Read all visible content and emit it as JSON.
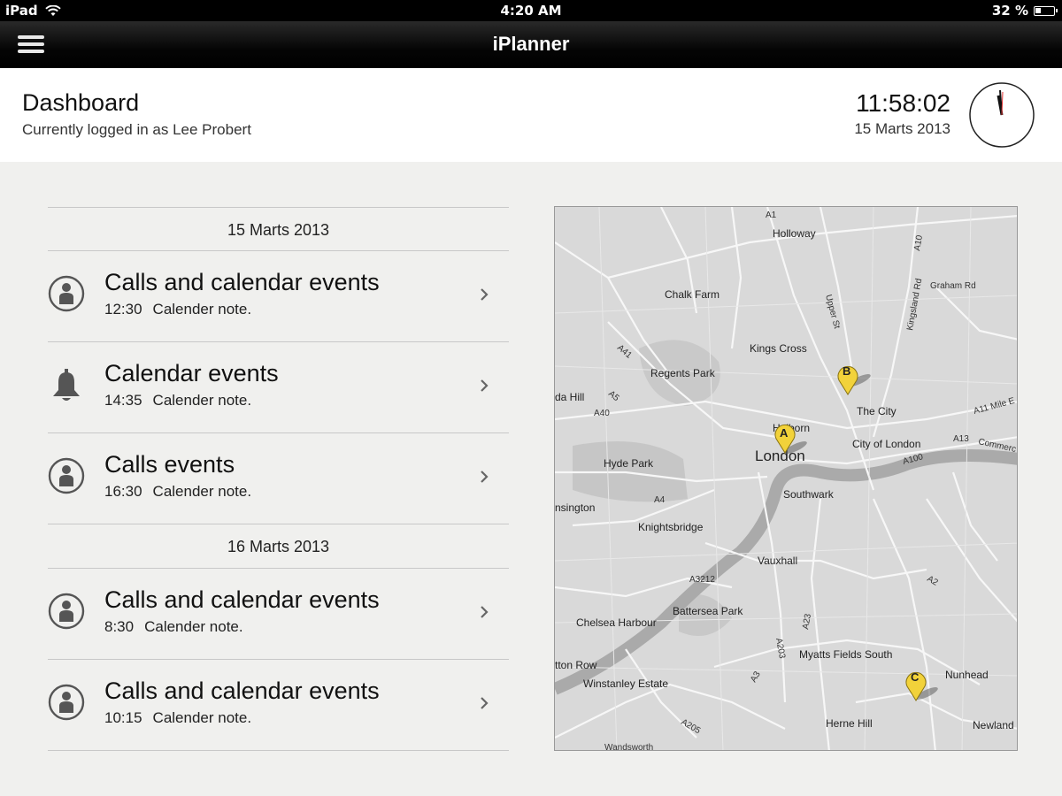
{
  "status_bar": {
    "device": "iPad",
    "time": "4:20 AM",
    "battery": "32 %"
  },
  "nav": {
    "title": "iPlanner",
    "menu_icon": "hamburger-menu-icon"
  },
  "header": {
    "title": "Dashboard",
    "subtitle": "Currently logged in as Lee Probert",
    "clock_time": "11:58:02",
    "clock_date": "15 Marts 2013"
  },
  "list": {
    "section1": {
      "date": "15 Marts 2013",
      "items": [
        {
          "icon": "person-icon",
          "title": "Calls and calendar events",
          "time": "12:30",
          "note": "Calender note."
        },
        {
          "icon": "bell-icon",
          "title": "Calendar events",
          "time": "14:35",
          "note": "Calender note."
        },
        {
          "icon": "person-icon",
          "title": "Calls events",
          "time": "16:30",
          "note": "Calender note."
        }
      ]
    },
    "section2": {
      "date": "16 Marts 2013",
      "items": [
        {
          "icon": "person-icon",
          "title": "Calls and calendar events",
          "time": "8:30",
          "note": "Calender note."
        },
        {
          "icon": "person-icon",
          "title": "Calls and calendar events",
          "time": "10:15",
          "note": "Calender note."
        }
      ]
    }
  },
  "map": {
    "places": [
      "Holloway",
      "Chalk Farm",
      "Kings Cross",
      "Regents Park",
      "The City",
      "City of London",
      "Hyde Park",
      "London",
      "Southwark",
      "Knightsbridge",
      "Vauxhall",
      "Battersea Park",
      "Chelsea Harbour",
      "Myatts Fields South",
      "Nunhead",
      "Winstanley Estate",
      "Herne Hill",
      "Newland",
      "da Hill",
      "nsington",
      "tton Row",
      "Graham Rd",
      "Holborn",
      "Wandsworth"
    ],
    "roads": [
      "A1",
      "A10",
      "A40",
      "A5",
      "A41",
      "A4",
      "A3212",
      "A203",
      "A23",
      "A3",
      "A2",
      "A205",
      "A13",
      "A11 Mile E",
      "A100",
      "Upper St",
      "Kingsland Rd",
      "Commerc"
    ],
    "markers": [
      "A",
      "B",
      "C"
    ]
  },
  "colors": {
    "marker": "#f2d23a",
    "nav_bg": "#000000",
    "map_bg": "#d9d9d9"
  }
}
